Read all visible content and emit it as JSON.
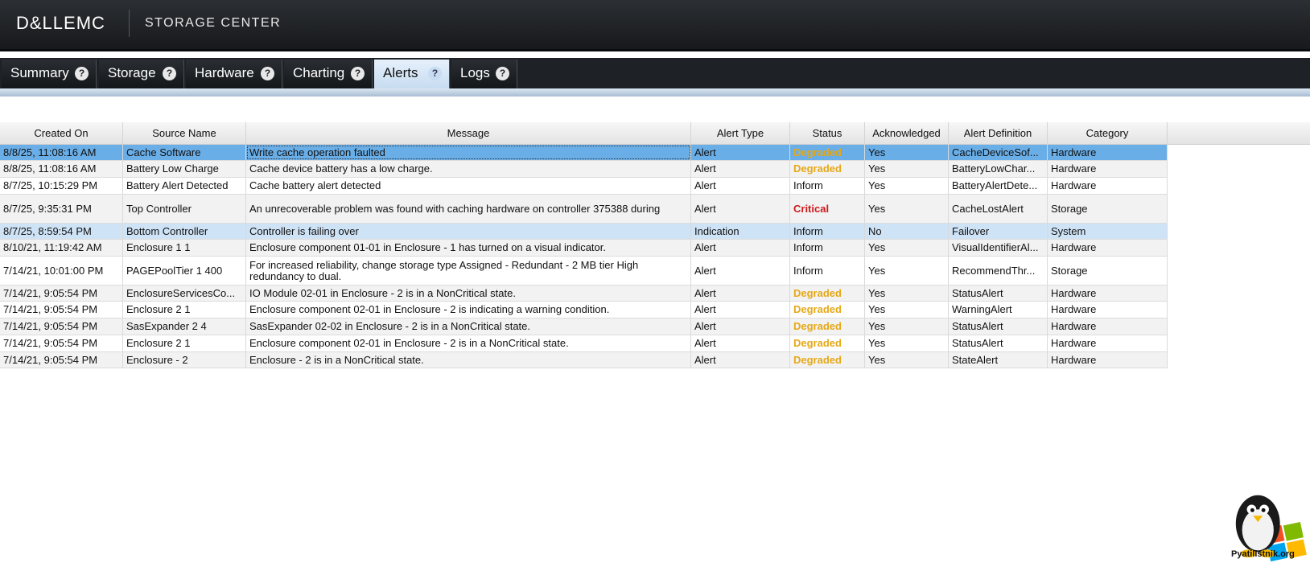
{
  "header": {
    "brand": "D&LLEMC",
    "product": "STORAGE CENTER"
  },
  "tabs": [
    {
      "label": "Summary",
      "active": false
    },
    {
      "label": "Storage",
      "active": false
    },
    {
      "label": "Hardware",
      "active": false
    },
    {
      "label": "Charting",
      "active": false
    },
    {
      "label": "Alerts",
      "active": true
    },
    {
      "label": "Logs",
      "active": false
    }
  ],
  "table": {
    "columns": [
      "Created On",
      "Source Name",
      "Message",
      "Alert Type",
      "Status",
      "Acknowledged",
      "Alert Definition",
      "Category"
    ],
    "rows": [
      [
        "8/8/25, 11:08:16 AM",
        "Cache Software",
        "Write cache operation faulted",
        "Alert",
        "Degraded",
        "Yes",
        "CacheDeviceSof...",
        "Hardware"
      ],
      [
        "8/8/25, 11:08:16 AM",
        "Battery Low Charge",
        "Cache device battery has a low charge.",
        "Alert",
        "Degraded",
        "Yes",
        "BatteryLowChar...",
        "Hardware"
      ],
      [
        "8/7/25, 10:15:29 PM",
        "Battery Alert Detected",
        "Cache battery alert detected",
        "Alert",
        "Inform",
        "Yes",
        "BatteryAlertDete...",
        "Hardware"
      ],
      [
        "8/7/25, 9:35:31 PM",
        "Top Controller",
        "An unrecoverable problem was found with caching hardware on controller 375388 during",
        "Alert",
        "Critical",
        "Yes",
        "CacheLostAlert",
        "Storage"
      ],
      [
        "8/7/25, 8:59:54 PM",
        "Bottom Controller",
        "Controller is failing over",
        "Indication",
        "Inform",
        "No",
        "Failover",
        "System"
      ],
      [
        "8/10/21, 11:19:42 AM",
        "Enclosure 1 1",
        "Enclosure component 01-01 in Enclosure - 1 has turned on a visual indicator.",
        "Alert",
        "Inform",
        "Yes",
        "VisualIdentifierAl...",
        "Hardware"
      ],
      [
        "7/14/21, 10:01:00 PM",
        "PAGEPoolTier 1 400",
        "For increased reliability, change storage type Assigned - Redundant - 2 MB tier High redundancy to dual.",
        "Alert",
        "Inform",
        "Yes",
        "RecommendThr...",
        "Storage"
      ],
      [
        "7/14/21, 9:05:54 PM",
        "EnclosureServicesCo...",
        "IO Module 02-01 in Enclosure - 2 is in a NonCritical state.",
        "Alert",
        "Degraded",
        "Yes",
        "StatusAlert",
        "Hardware"
      ],
      [
        "7/14/21, 9:05:54 PM",
        "Enclosure 2 1",
        "Enclosure component 02-01 in Enclosure - 2 is indicating a warning condition.",
        "Alert",
        "Degraded",
        "Yes",
        "WarningAlert",
        "Hardware"
      ],
      [
        "7/14/21, 9:05:54 PM",
        "SasExpander 2 4",
        "SasExpander 02-02 in Enclosure - 2 is in a NonCritical state.",
        "Alert",
        "Degraded",
        "Yes",
        "StatusAlert",
        "Hardware"
      ],
      [
        "7/14/21, 9:05:54 PM",
        "Enclosure 2 1",
        "Enclosure component 02-01 in Enclosure - 2 is in a NonCritical state.",
        "Alert",
        "Degraded",
        "Yes",
        "StatusAlert",
        "Hardware"
      ],
      [
        "7/14/21, 9:05:54 PM",
        "Enclosure - 2",
        "Enclosure - 2 is in a NonCritical state.",
        "Alert",
        "Degraded",
        "Yes",
        "StateAlert",
        "Hardware"
      ]
    ],
    "selected_row": 0,
    "hover_row": 4
  },
  "watermark": {
    "text": "Pyatilistnik.org"
  },
  "colors": {
    "degraded": "#e6a817",
    "critical": "#cc1b1b",
    "selected_row": "#6aaee8",
    "hover_row": "#cfe3f6"
  }
}
